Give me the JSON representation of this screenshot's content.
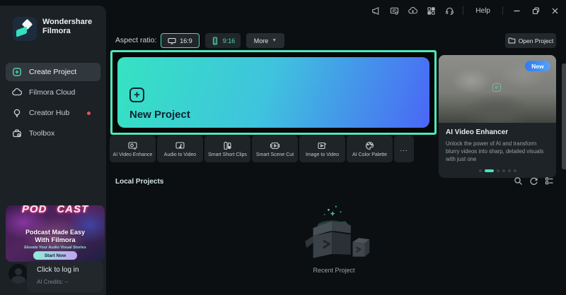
{
  "window": {
    "help_label": "Help",
    "topbar_icons": [
      "megaphone",
      "feedback",
      "cloud-sync",
      "apps",
      "support"
    ]
  },
  "brand": {
    "name_line1": "Wondershare",
    "name_line2": "Filmora"
  },
  "sidebar": {
    "items": [
      {
        "label": "Create Project",
        "active": true
      },
      {
        "label": "Filmora Cloud",
        "active": false
      },
      {
        "label": "Creator Hub",
        "active": false,
        "notification": true
      },
      {
        "label": "Toolbox",
        "active": false
      }
    ],
    "promo": {
      "title_left": "POD",
      "title_right": "CAST",
      "headline1": "Podcast Made Easy",
      "headline2": "With Filmora",
      "subline": "Elevate Your Audio Visual Stories",
      "cta": "Start Now"
    },
    "account": {
      "login_label": "Click to log in",
      "credits_label": "AI Credits: –"
    }
  },
  "main": {
    "aspect": {
      "label": "Aspect ratio:",
      "options": [
        {
          "label": "16:9",
          "selected": true
        },
        {
          "label": "9:16",
          "selected": false
        }
      ],
      "more_label": "More"
    },
    "open_project_label": "Open Project",
    "new_project_label": "New Project",
    "tools": [
      {
        "label": "AI Video Enhance"
      },
      {
        "label": "Audio to Video"
      },
      {
        "label": "Smart Short Clips"
      },
      {
        "label": "Smart Scene Cut"
      },
      {
        "label": "Image to Video"
      },
      {
        "label": "AI Color Palette"
      }
    ],
    "tools_more_label": "...",
    "feature": {
      "badge": "New",
      "title": "AI Video Enhancer",
      "description": "Unlock the power of AI and transform blurry videos into sharp, detailed visuals with just one",
      "dots_total": 6,
      "active_dot": 2
    },
    "local_projects_label": "Local Projects",
    "empty_label": "Recent Project"
  },
  "colors": {
    "accent_teal": "#4be0b8",
    "highlight_border": "#4fe7bb",
    "card_gradient_start": "#35e3c2",
    "card_gradient_end": "#4a67f6",
    "badge_blue": "#2f7bf0",
    "notification_red": "#e05656"
  }
}
